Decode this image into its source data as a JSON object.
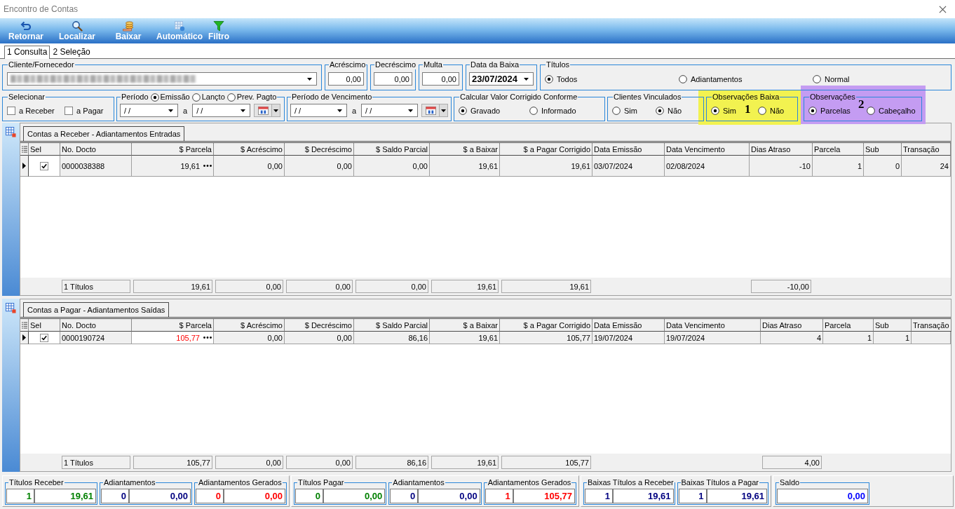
{
  "window": {
    "title": "Encontro de Contas"
  },
  "toolbar": [
    {
      "label": "Retornar",
      "kind": "return"
    },
    {
      "label": "Localizar",
      "kind": "search"
    },
    {
      "label": "Baixar",
      "kind": "coins"
    },
    {
      "label": "Automático",
      "kind": "grid"
    },
    {
      "label": "Filtro",
      "kind": "filter"
    }
  ],
  "tabs": [
    {
      "label": "1 Consulta",
      "selected": true
    },
    {
      "label": "2 Seleção",
      "selected": false
    }
  ],
  "filters_row_1": [
    {
      "kind": "lookup",
      "title": "Cliente/Fornecedor",
      "blurred": true
    },
    {
      "kind": "amount",
      "title": "Acréscimo",
      "value": "0,00"
    },
    {
      "kind": "amount",
      "title": "Decréscimo",
      "value": "0,00"
    },
    {
      "kind": "amount",
      "title": "Multa",
      "value": "0,00"
    },
    {
      "kind": "date",
      "title": "Data da Baixa",
      "value": "23/07/2024"
    },
    {
      "kind": "radio",
      "title": "Títulos",
      "options": [
        {
          "label": "Todos",
          "selected": true
        },
        {
          "label": "Adiantamentos",
          "selected": false
        },
        {
          "label": "Normal",
          "selected": false
        }
      ]
    }
  ],
  "filters_row_2": [
    {
      "kind": "checks",
      "title": "Selecionar",
      "options": [
        {
          "label": "a Receber",
          "checked": false
        },
        {
          "label": "a Pagar",
          "checked": false
        }
      ]
    },
    {
      "kind": "period",
      "title": "Período",
      "title_options": [
        {
          "label": "Emissão",
          "selected": true
        },
        {
          "label": "Lançto",
          "selected": false
        },
        {
          "label": "Prev. Pagto",
          "selected": false
        }
      ],
      "from": "/ /",
      "separator": "a",
      "to": "/ /"
    },
    {
      "kind": "period",
      "title": "Período de Vencimento",
      "from": "/ /",
      "separator": "a",
      "to": "/ /"
    },
    {
      "kind": "radio",
      "title": "Calcular Valor Corrigido Conforme",
      "options": [
        {
          "label": "Gravado",
          "selected": true
        },
        {
          "label": "Informado",
          "selected": false
        }
      ]
    },
    {
      "kind": "radio",
      "title": "Clientes Vinculados",
      "options": [
        {
          "label": "Sim",
          "selected": false
        },
        {
          "label": "Não",
          "selected": true
        }
      ]
    },
    {
      "kind": "radio",
      "title": "Observações Baixa",
      "options": [
        {
          "label": "Sim",
          "selected": true
        },
        {
          "label": "Não",
          "selected": false
        }
      ],
      "annotation": {
        "label": "1",
        "color": "#f2f250"
      }
    },
    {
      "kind": "radio",
      "title": "Observações",
      "options": [
        {
          "label": "Parcelas",
          "selected": true
        },
        {
          "label": "Cabeçalho",
          "selected": false
        }
      ],
      "annotation": {
        "label": "2",
        "color": "#c49cf2"
      }
    }
  ],
  "grids": [
    {
      "tab": "Contas a Receber - Adiantamentos Entradas",
      "check_column": {
        "label": "Sel"
      },
      "columns": [
        {
          "label": "No. Docto",
          "kind": "text"
        },
        {
          "label": "$ Parcela",
          "kind": "lookup"
        },
        {
          "label": "$ Acréscimo",
          "kind": "money"
        },
        {
          "label": "$ Decréscimo",
          "kind": "money"
        },
        {
          "label": "$ Saldo Parcial",
          "kind": "money"
        },
        {
          "label": "$ a Baixar",
          "kind": "money"
        },
        {
          "label": "$ a Pagar Corrigido",
          "kind": "money"
        },
        {
          "label": "Data Emissão",
          "kind": "text"
        },
        {
          "label": "Data Vencimento",
          "kind": "text"
        },
        {
          "label": "Dias Atraso",
          "kind": "count"
        },
        {
          "label": "Parcela",
          "kind": "count"
        },
        {
          "label": "Sub",
          "kind": "count"
        },
        {
          "label": "Transação",
          "kind": "count"
        }
      ],
      "rows": [
        {
          "current": true,
          "checked": true,
          "focused_cell": false,
          "cells": [
            "0000038388",
            "19,61",
            "0,00",
            "0,00",
            "0,00",
            "19,61",
            "19,61",
            "03/07/2024",
            "02/08/2024",
            "-10",
            "1",
            "0",
            "24"
          ]
        }
      ],
      "totals": [
        "1 Títulos",
        "19,61",
        "0,00",
        "0,00",
        "0,00",
        "19,61",
        "19,61"
      ],
      "dias_atraso_total": "-10,00"
    },
    {
      "tab": "Contas a Pagar - Adiantamentos Saídas",
      "check_column": {
        "label": "Sel"
      },
      "columns": [
        {
          "label": "No. Docto",
          "kind": "text"
        },
        {
          "label": "$ Parcela",
          "kind": "lookup"
        },
        {
          "label": "$ Acréscimo",
          "kind": "money"
        },
        {
          "label": "$ Decréscimo",
          "kind": "money"
        },
        {
          "label": "$ Saldo Parcial",
          "kind": "money"
        },
        {
          "label": "$ a Baixar",
          "kind": "money"
        },
        {
          "label": "$ a Pagar Corrigido",
          "kind": "money"
        },
        {
          "label": "Data Emissão",
          "kind": "text"
        },
        {
          "label": "Data Vencimento",
          "kind": "text"
        },
        {
          "label": "Dias Atraso",
          "kind": "count"
        },
        {
          "label": "Parcela",
          "kind": "count"
        },
        {
          "label": "Sub",
          "kind": "count"
        },
        {
          "label": "Transação",
          "kind": "count"
        }
      ],
      "rows": [
        {
          "current": true,
          "checked": true,
          "focused_cell": true,
          "cells": [
            "0000190724",
            "105,77",
            "0,00",
            "0,00",
            "86,16",
            "19,61",
            "105,77",
            "19/07/2024",
            "19/07/2024",
            "4",
            "1",
            "1"
          ]
        }
      ],
      "totals": [
        "1 Títulos",
        "105,77",
        "0,00",
        "0,00",
        "86,16",
        "19,61",
        "105,77"
      ],
      "dias_atraso_total": "4,00"
    }
  ],
  "summary": [
    [
      {
        "label": "Títulos Receber",
        "count": "1",
        "value": "19,61",
        "color": "#008000"
      },
      {
        "label": "Adiantamentos",
        "count": "0",
        "value": "0,00",
        "color": "#000080"
      },
      {
        "label": "Adiantamentos Gerados",
        "count": "0",
        "value": "0,00",
        "color": "#ff0000"
      }
    ],
    [
      {
        "label": "Títulos Pagar",
        "count": "0",
        "value": "0,00",
        "color": "#008000"
      },
      {
        "label": "Adiantamentos",
        "count": "0",
        "value": "0,00",
        "color": "#000080"
      },
      {
        "label": "Adiantamentos Gerados",
        "count": "1",
        "value": "105,77",
        "color": "#ff0000"
      }
    ],
    [
      {
        "label": "Baixas Títulos a Receber",
        "count": "1",
        "value": "19,61",
        "color": "#000080"
      },
      {
        "label": "Baixas Títulos a Pagar",
        "count": "1",
        "value": "19,61",
        "color": "#000080"
      }
    ],
    [
      {
        "label": "Saldo",
        "value": "0,00",
        "color": "#0000ff"
      }
    ]
  ]
}
